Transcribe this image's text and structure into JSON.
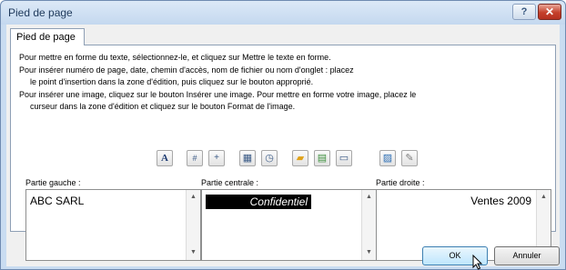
{
  "window": {
    "title": "Pied de page",
    "help_label": "?",
    "close_label": "✕"
  },
  "tab": {
    "label": "Pied de page"
  },
  "instructions": {
    "line1": "Pour mettre en forme du texte, sélectionnez-le, et cliquez sur Mettre le texte en forme.",
    "line2": "Pour insérer numéro de page, date, chemin  d'accès, nom de fichier ou nom d'onglet  : placez",
    "line3": "le point d'insertion dans la zone d'édition, puis cliquez sur le bouton approprié.",
    "line4": "Pour insérer une image, cliquez sur le bouton Insérer une image. Pour mettre en forme votre image, placez le",
    "line5": "curseur dans la zone d'édition et cliquez sur le bouton Format de l'image."
  },
  "toolbar": {
    "items": [
      {
        "icon": "format-text-icon",
        "glyph": "A"
      },
      {
        "icon": "page-number-icon",
        "glyph": "#"
      },
      {
        "icon": "page-count-icon",
        "glyph": "+"
      },
      {
        "icon": "date-icon",
        "glyph": "▦"
      },
      {
        "icon": "time-icon",
        "glyph": "◷"
      },
      {
        "icon": "file-path-icon",
        "glyph": "▰"
      },
      {
        "icon": "file-name-icon",
        "glyph": "▤"
      },
      {
        "icon": "sheet-name-icon",
        "glyph": "▭"
      },
      {
        "icon": "insert-picture-icon",
        "glyph": "▨"
      },
      {
        "icon": "format-picture-icon",
        "glyph": "✎"
      }
    ]
  },
  "sections": {
    "left": {
      "label": "Partie gauche :",
      "value": "ABC SARL"
    },
    "center": {
      "label": "Partie centrale :",
      "value": "Confidentiel"
    },
    "right": {
      "label": "Partie droite :",
      "value": "Ventes 2009"
    }
  },
  "buttons": {
    "ok": "OK",
    "cancel": "Annuler"
  },
  "colors": {
    "accent": "#3c7fb1",
    "close": "#c5402b"
  }
}
